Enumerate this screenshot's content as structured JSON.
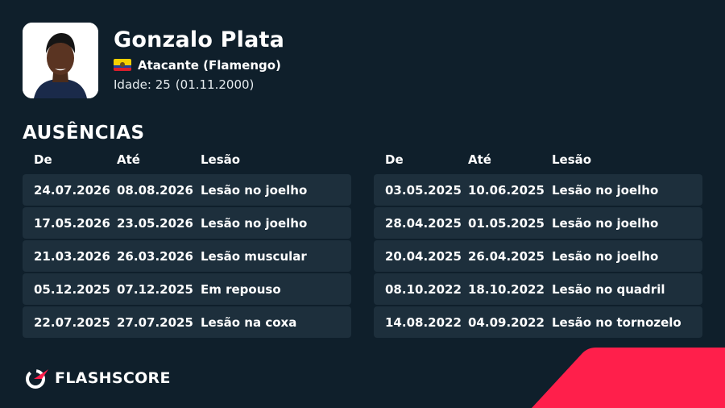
{
  "player": {
    "name": "Gonzalo Plata",
    "position": "Atacante (Flamengo)",
    "age_label": "Idade: 25",
    "dob": "(01.11.2000)"
  },
  "section_title": "AUSÊNCIAS",
  "columns": {
    "from": "De",
    "to": "Até",
    "injury": "Lesão"
  },
  "left_rows": [
    {
      "from": "24.07.2026",
      "to": "08.08.2026",
      "injury": "Lesão no joelho"
    },
    {
      "from": "17.05.2026",
      "to": "23.05.2026",
      "injury": "Lesão no joelho"
    },
    {
      "from": "21.03.2026",
      "to": "26.03.2026",
      "injury": "Lesão muscular"
    },
    {
      "from": "05.12.2025",
      "to": "07.12.2025",
      "injury": "Em repouso"
    },
    {
      "from": "22.07.2025",
      "to": "27.07.2025",
      "injury": "Lesão na coxa"
    }
  ],
  "right_rows": [
    {
      "from": "03.05.2025",
      "to": "10.06.2025",
      "injury": "Lesão no joelho"
    },
    {
      "from": "28.04.2025",
      "to": "01.05.2025",
      "injury": "Lesão no joelho"
    },
    {
      "from": "20.04.2025",
      "to": "26.04.2025",
      "injury": "Lesão no joelho"
    },
    {
      "from": "08.10.2022",
      "to": "18.10.2022",
      "injury": "Lesão no quadril"
    },
    {
      "from": "14.08.2022",
      "to": "04.09.2022",
      "injury": "Lesão no tornozelo"
    }
  ],
  "brand": {
    "name": "FLASHSCORE"
  },
  "icons": {
    "photo": "player-photo",
    "flag": "ecuador-flag-icon",
    "logo": "flashscore-logo-icon"
  },
  "colors": {
    "background": "#0f1f2b",
    "row": "#1d2f3c",
    "accent": "#ff1f4b"
  }
}
